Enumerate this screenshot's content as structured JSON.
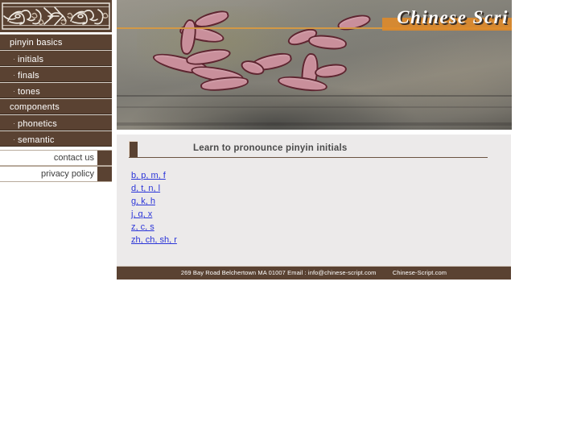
{
  "sidebar": {
    "logo": {
      "name": "chinese-bronze-motif-logo",
      "bg": "#5a4232"
    },
    "nav": [
      {
        "label": "pinyin basics",
        "sub": false
      },
      {
        "label": "initials",
        "sub": true
      },
      {
        "label": "finals",
        "sub": true
      },
      {
        "label": "tones",
        "sub": true
      },
      {
        "label": "components",
        "sub": false
      },
      {
        "label": "phonetics",
        "sub": true
      },
      {
        "label": "semantic",
        "sub": true
      }
    ],
    "links": [
      {
        "label": "contact us"
      },
      {
        "label": "privacy policy"
      }
    ]
  },
  "banner": {
    "title": "Chinese Scri",
    "band_color": "#e08a28",
    "photo_alt": "carved chinese characters in rock painted pink"
  },
  "content": {
    "heading": "Learn to pronounce pinyin initials",
    "marker_color": "#5a4232",
    "links": [
      "b, p, m, f",
      "d, t, n, l",
      "g, k, h",
      "j, q, x",
      "z, c, s",
      "zh, ch, sh, r"
    ]
  },
  "footer": {
    "address": "269 Bay Road Belchertown MA 01007 Email : info@chinese-script.com",
    "site": "Chinese-Script.com"
  }
}
